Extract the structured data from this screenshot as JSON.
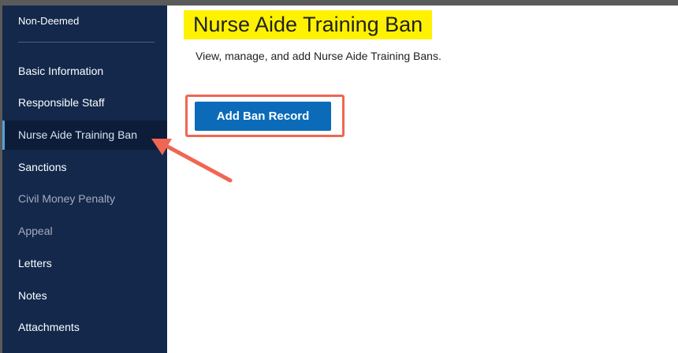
{
  "sidebar": {
    "header": "Non-Deemed",
    "items": [
      {
        "label": "Basic Information",
        "state": "normal"
      },
      {
        "label": "Responsible Staff",
        "state": "normal"
      },
      {
        "label": "Nurse Aide Training Ban",
        "state": "active"
      },
      {
        "label": "Sanctions",
        "state": "normal"
      },
      {
        "label": "Civil Money Penalty",
        "state": "disabled"
      },
      {
        "label": "Appeal",
        "state": "disabled"
      },
      {
        "label": "Letters",
        "state": "normal"
      },
      {
        "label": "Notes",
        "state": "normal"
      },
      {
        "label": "Attachments",
        "state": "normal"
      }
    ]
  },
  "main": {
    "title": "Nurse Aide Training Ban",
    "description": "View, manage, and add Nurse Aide Training Bans.",
    "add_button_label": "Add Ban Record"
  },
  "colors": {
    "sidebar_bg": "#13284b",
    "title_highlight": "#fff200",
    "button_bg": "#0b6bb8",
    "annotation": "#f06652"
  }
}
